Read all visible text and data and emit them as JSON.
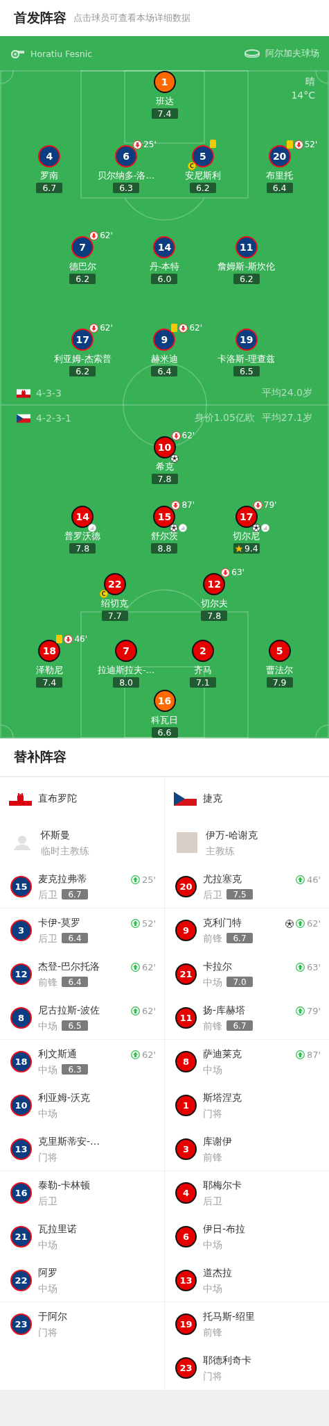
{
  "header": {
    "title": "首发阵容",
    "subtitle": "点击球员可查看本场详细数据"
  },
  "match_info": {
    "referee": "Horatiu Fesnic",
    "stadium": "阿尔加夫球场",
    "weather": "晴",
    "temperature": "14°C"
  },
  "home": {
    "flag": {
      "kind": "gibraltar"
    },
    "color": "#0b3d80",
    "formation": "4-3-3",
    "average_age": "平均24.0岁",
    "lines": [
      [
        {
          "number": "1",
          "name": "班达",
          "rating": "7.4",
          "kind": "goalkeeper"
        }
      ],
      [
        {
          "number": "4",
          "name": "罗南",
          "rating": "6.7",
          "kind": "outfield"
        },
        {
          "number": "6",
          "name": "贝尔纳多-洛…",
          "rating": "6.3",
          "kind": "outfield",
          "events": [
            {
              "kind": "substituted_off",
              "minute": "25'"
            }
          ]
        },
        {
          "number": "5",
          "name": "安尼斯利",
          "rating": "6.2",
          "kind": "outfield",
          "events": [
            {
              "kind": "yellow_card"
            },
            {
              "kind": "captain",
              "label": "C"
            }
          ]
        },
        {
          "number": "20",
          "name": "布里托",
          "rating": "6.4",
          "kind": "outfield",
          "events": [
            {
              "kind": "yellow_card"
            },
            {
              "kind": "substituted_off",
              "minute": "52'"
            }
          ]
        }
      ],
      [
        {
          "number": "7",
          "name": "德巴尔",
          "rating": "6.2",
          "kind": "outfield",
          "events": [
            {
              "kind": "substituted_off",
              "minute": "62'"
            }
          ]
        },
        {
          "number": "14",
          "name": "丹-本特",
          "rating": "6.0",
          "kind": "outfield"
        },
        {
          "number": "11",
          "name": "詹姆斯-斯坎伦",
          "rating": "6.2",
          "kind": "outfield"
        }
      ],
      [
        {
          "number": "17",
          "name": "利亚姆-杰索普",
          "rating": "6.2",
          "kind": "outfield",
          "events": [
            {
              "kind": "substituted_off",
              "minute": "62'"
            }
          ]
        },
        {
          "number": "9",
          "name": "赫米迪",
          "rating": "6.4",
          "kind": "outfield",
          "events": [
            {
              "kind": "yellow_card"
            },
            {
              "kind": "substituted_off",
              "minute": "62'"
            }
          ]
        },
        {
          "number": "19",
          "name": "卡洛斯-理查兹",
          "rating": "6.5",
          "kind": "outfield"
        }
      ]
    ]
  },
  "away": {
    "flag": {
      "kind": "czech"
    },
    "color": "#e60000",
    "formation": "4-2-3-1",
    "market_value": "身价1.05亿欧",
    "average_age": "平均27.1岁",
    "lines": [
      [
        {
          "number": "10",
          "name": "希克",
          "rating": "7.8",
          "kind": "outfield",
          "events": [
            {
              "kind": "substituted_off",
              "minute": "62'"
            },
            {
              "kind": "goal"
            }
          ]
        }
      ],
      [
        {
          "number": "14",
          "name": "普罗沃德",
          "rating": "7.8",
          "kind": "outfield",
          "events": [
            {
              "kind": "assist"
            }
          ]
        },
        {
          "number": "15",
          "name": "舒尔茨",
          "rating": "8.8",
          "kind": "outfield",
          "events": [
            {
              "kind": "substituted_off",
              "minute": "87'"
            },
            {
              "kind": "goal"
            },
            {
              "kind": "assist"
            }
          ]
        },
        {
          "number": "17",
          "name": "切尔尼",
          "rating": "9.4",
          "kind": "outfield",
          "best": true,
          "events": [
            {
              "kind": "substituted_off",
              "minute": "79'"
            },
            {
              "kind": "goal"
            },
            {
              "kind": "assist"
            }
          ]
        }
      ],
      [
        {
          "number": "22",
          "name": "绍切克",
          "rating": "7.7",
          "kind": "outfield",
          "events": [
            {
              "kind": "captain",
              "label": "C"
            }
          ]
        },
        {
          "number": "12",
          "name": "切尔夫",
          "rating": "7.8",
          "kind": "outfield",
          "events": [
            {
              "kind": "substituted_off",
              "minute": "63'"
            }
          ]
        }
      ],
      [
        {
          "number": "18",
          "name": "泽勒尼",
          "rating": "7.4",
          "kind": "outfield",
          "events": [
            {
              "kind": "yellow_card"
            },
            {
              "kind": "substituted_off",
              "minute": "46'"
            }
          ]
        },
        {
          "number": "7",
          "name": "拉迪斯拉夫-…",
          "rating": "8.0",
          "kind": "outfield"
        },
        {
          "number": "2",
          "name": "齐马",
          "rating": "7.1",
          "kind": "outfield"
        },
        {
          "number": "5",
          "name": "曹法尔",
          "rating": "7.9",
          "kind": "outfield"
        }
      ],
      [
        {
          "number": "16",
          "name": "科瓦日",
          "rating": "6.6",
          "kind": "goalkeeper"
        }
      ]
    ]
  },
  "substitutes": {
    "title": "替补阵容",
    "teams": [
      {
        "name": "直布罗陀",
        "flag": {
          "kind": "gibraltar"
        },
        "coach": {
          "name": "怀斯曼",
          "role": "临时主教练",
          "avatar": {
            "kind": "silhouette"
          }
        },
        "players": [
          {
            "number": "15",
            "name": "麦克拉弗蒂",
            "position": "后卫",
            "rating": "6.7",
            "events": [
              {
                "kind": "substituted_on",
                "minute": "25'"
              }
            ]
          },
          {
            "number": "3",
            "name": "卡伊-莫罗",
            "position": "后卫",
            "rating": "6.4",
            "events": [
              {
                "kind": "substituted_on",
                "minute": "52'"
              }
            ]
          },
          {
            "number": "12",
            "name": "杰登-巴尔托洛",
            "position": "前锋",
            "rating": "6.4",
            "events": [
              {
                "kind": "substituted_on",
                "minute": "62'"
              }
            ]
          },
          {
            "number": "8",
            "name": "尼古拉斯-波佐",
            "position": "中场",
            "rating": "6.5",
            "events": [
              {
                "kind": "substituted_on",
                "minute": "62'"
              }
            ]
          },
          {
            "number": "18",
            "name": "利文斯通",
            "position": "中场",
            "rating": "6.3",
            "events": [
              {
                "kind": "substituted_on",
                "minute": "62'"
              }
            ]
          },
          {
            "number": "10",
            "name": "利亚姆-沃克",
            "position": "中场"
          },
          {
            "number": "13",
            "name": "克里斯蒂安-…",
            "position": "门将"
          },
          {
            "number": "16",
            "name": "泰勒-卡林顿",
            "position": "后卫"
          },
          {
            "number": "21",
            "name": "瓦拉里诺",
            "position": "中场"
          },
          {
            "number": "22",
            "name": "阿罗",
            "position": "中场"
          },
          {
            "number": "23",
            "name": "于阿尔",
            "position": "门将"
          }
        ]
      },
      {
        "name": "捷克",
        "flag": {
          "kind": "czech"
        },
        "coach": {
          "name": "伊万-哈谢克",
          "role": "主教练",
          "avatar": {
            "kind": "photo"
          }
        },
        "players": [
          {
            "number": "20",
            "name": "尤拉塞克",
            "position": "后卫",
            "rating": "7.5",
            "events": [
              {
                "kind": "substituted_on",
                "minute": "46'"
              }
            ]
          },
          {
            "number": "9",
            "name": "克利门特",
            "position": "前锋",
            "rating": "6.7",
            "events": [
              {
                "kind": "goal"
              },
              {
                "kind": "substituted_on",
                "minute": "62'"
              }
            ]
          },
          {
            "number": "21",
            "name": "卡拉尔",
            "position": "中场",
            "rating": "7.0",
            "events": [
              {
                "kind": "substituted_on",
                "minute": "63'"
              }
            ]
          },
          {
            "number": "11",
            "name": "扬-库赫塔",
            "position": "前锋",
            "rating": "6.7",
            "events": [
              {
                "kind": "substituted_on",
                "minute": "79'"
              }
            ]
          },
          {
            "number": "8",
            "name": "萨迪莱克",
            "position": "中场",
            "events": [
              {
                "kind": "substituted_on",
                "minute": "87'"
              }
            ]
          },
          {
            "number": "1",
            "name": "斯塔涅克",
            "position": "门将"
          },
          {
            "number": "3",
            "name": "库谢伊",
            "position": "前锋"
          },
          {
            "number": "4",
            "name": "耶梅尔卡",
            "position": "后卫"
          },
          {
            "number": "6",
            "name": "伊日-布拉",
            "position": "中场"
          },
          {
            "number": "13",
            "name": "道杰拉",
            "position": "中场"
          },
          {
            "number": "19",
            "name": "托马斯-绍里",
            "position": "前锋"
          },
          {
            "number": "23",
            "name": "耶德利奇卡",
            "position": "门将"
          }
        ]
      }
    ]
  }
}
